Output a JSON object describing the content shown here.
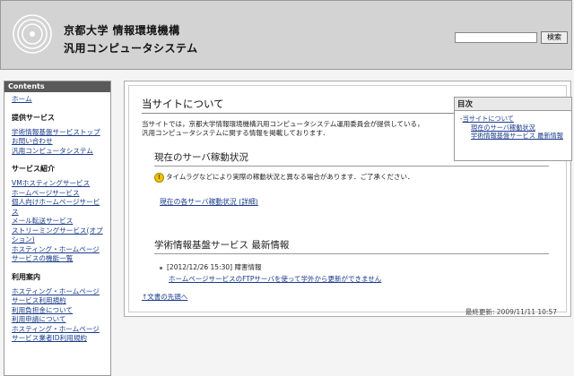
{
  "header": {
    "org": "京都大学 情報環境機構",
    "system": "汎用コンピュータシステム",
    "search_button": "検索",
    "search_value": ""
  },
  "sidebar": {
    "title": "Contents",
    "home": "ホーム",
    "sections": [
      {
        "title": "提供サービス",
        "links": [
          "学術情報基盤サービストップ",
          "お問い合わせ",
          "汎用コンピュータシステム"
        ]
      },
      {
        "title": "サービス紹介",
        "links": [
          "VMホスティングサービス",
          "ホームページサービス",
          "個人向けホームページサービス",
          "メール転送サービス",
          "ストリーミングサービス(オプション)",
          "ホスティング・ホームページサービスの機能一覧"
        ]
      },
      {
        "title": "利用案内",
        "links": [
          "ホスティング・ホームページサービス利用規約",
          "利用負担金について",
          "利用申請について",
          "ホスティング・ホームページサービス業者ID利用規約"
        ]
      }
    ]
  },
  "main": {
    "title": "当サイトについて",
    "intro": "当サイトでは，京都大学情報環境機構汎用コンピュータシステム運用委員会が提供している，汎用コンピュータシステムに関する情報を掲載しております．",
    "toc": {
      "title": "目次",
      "item1": "当サイトについて",
      "item1_prefix": "-",
      "sub1": "現在のサーバ稼動状況",
      "sub2": "学術情報基盤サービス 最新情報"
    },
    "status_heading": "現在のサーバ稼動状況",
    "notice": "タイムラグなどにより実際の稼動状況と異なる場合があります．ご了承ください．",
    "status_link": "現在の各サーバ稼動状況 (詳細)",
    "news_heading": "学術情報基盤サービス 最新情報",
    "news_date": "[2012/12/26 15:30] 障害情報",
    "news_link": "ホームページサービスのFTPサーバを使って学外から更新ができません",
    "back_to_top": "文書の先頭へ",
    "updated": "最終更新: 2009/11/11 10:57"
  }
}
